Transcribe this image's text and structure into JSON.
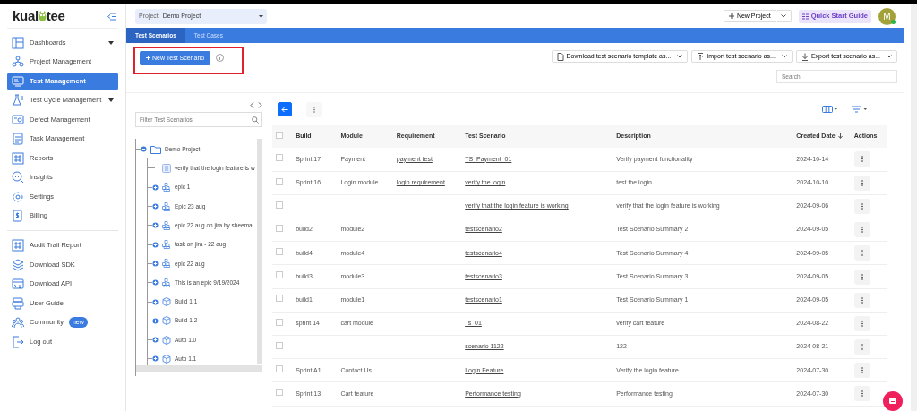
{
  "logo": {
    "text_start": "kual",
    "text_end": "tee"
  },
  "sidebar": {
    "groups": [
      [
        {
          "label": "Dashboards",
          "selected": false,
          "expanded": false
        },
        {
          "label": "Project Management",
          "selected": false
        },
        {
          "label": "Test Management",
          "selected": true
        },
        {
          "label": "Test Cycle Management",
          "selected": false,
          "expanded": false
        },
        {
          "label": "Defect Management",
          "selected": false
        },
        {
          "label": "Task Management",
          "selected": false
        },
        {
          "label": "Reports",
          "selected": false
        },
        {
          "label": "Insights",
          "selected": false
        },
        {
          "label": "Settings",
          "selected": false
        },
        {
          "label": "Billing",
          "selected": false
        }
      ],
      [
        {
          "label": "Audit Trail Report",
          "selected": false
        },
        {
          "label": "Download SDK",
          "selected": false
        },
        {
          "label": "Download API",
          "selected": false
        },
        {
          "label": "User Guide",
          "selected": false
        },
        {
          "label": "Community",
          "selected": false,
          "badge": "new"
        },
        {
          "label": "Log out",
          "selected": false
        }
      ]
    ]
  },
  "topbar": {
    "project_label": "Project:",
    "project": "Demo Project",
    "new_project": "New Project",
    "quick_start": "Quick Start Guide",
    "avatar": "M"
  },
  "tabs": [
    {
      "label": "Test Scenarios",
      "selected": true
    },
    {
      "label": "Test Cases",
      "selected": false
    }
  ],
  "new_button": "New Test Scenario",
  "actions": [
    {
      "label": "Download test scenario template as..."
    },
    {
      "label": "Import test scenario as..."
    },
    {
      "label": "Export test scenario as..."
    }
  ],
  "search": {
    "placeholder": "Search"
  },
  "tree": {
    "filter_placeholder": "Filter Test Scenarios",
    "nodes": [
      {
        "label": "Demo Project",
        "kind": "folder",
        "expanded": true,
        "children": [
          {
            "label": "verify that the login feature is w",
            "kind": "scenario"
          },
          {
            "label": "epic 1",
            "kind": "epic",
            "expanded": false
          },
          {
            "label": "Epic 23 aug",
            "kind": "epic",
            "expanded": false
          },
          {
            "label": "epic 22 aug on jira by sheema",
            "kind": "epic",
            "expanded": false
          },
          {
            "label": "task on jira - 22 aug",
            "kind": "epic",
            "expanded": false
          },
          {
            "label": "epic 22 aug",
            "kind": "epic",
            "expanded": false
          },
          {
            "label": "This is an epic 9/19/2024",
            "kind": "epic",
            "expanded": false
          },
          {
            "label": "Build 1.1",
            "kind": "build",
            "expanded": false
          },
          {
            "label": "Build 1.2",
            "kind": "build",
            "expanded": false
          },
          {
            "label": "Auto 1.0",
            "kind": "build",
            "expanded": false
          },
          {
            "label": "Auto 1.1",
            "kind": "build",
            "expanded": false
          }
        ]
      }
    ]
  },
  "table": {
    "columns": [
      "Build",
      "Module",
      "Requirement",
      "Test Scenario",
      "Description",
      "Created Date",
      "Actions"
    ],
    "all_checked": false,
    "rows": [
      {
        "checked": false,
        "build": "Sprint 17",
        "module": "Payment",
        "requirement": "payment test",
        "scenario": "TS_Payment_01",
        "description": "Verify payment functionality",
        "date": "2024-10-14"
      },
      {
        "checked": false,
        "build": "Sprint 16",
        "module": "Login module",
        "requirement": "login requirement",
        "scenario": "verify the login",
        "description": "test the login",
        "date": "2024-10-10"
      },
      {
        "checked": false,
        "scenario": "verify that the login feature is working",
        "description": "verify that the login feature is working",
        "date": "2024-09-06"
      },
      {
        "checked": false,
        "build": "build2",
        "module": "module2",
        "scenario": "testscenario2",
        "description": "Test Scenario Summary 2",
        "date": "2024-09-05"
      },
      {
        "checked": false,
        "build": "build4",
        "module": "module4",
        "scenario": "testscenario4",
        "description": "Test Scenario Summary 4",
        "date": "2024-09-05"
      },
      {
        "checked": false,
        "build": "build3",
        "module": "module3",
        "scenario": "testscenario3",
        "description": "Test Scenario Summary 3",
        "date": "2024-09-05"
      },
      {
        "checked": false,
        "build": "build1",
        "module": "module1",
        "scenario": "testscenario1",
        "description": "Test Scenario Summary 1",
        "date": "2024-09-05"
      },
      {
        "checked": false,
        "build": "sprint 14",
        "module": "cart module",
        "scenario": "Ts_01",
        "description": "verify cart feature",
        "date": "2024-08-22"
      },
      {
        "checked": false,
        "scenario": "scenario 1122",
        "description": "122",
        "date": "2024-08-21"
      },
      {
        "checked": false,
        "build": "Sprint A1",
        "module": "Contact Us",
        "scenario": "Login Feature",
        "description": "Verify the login feature",
        "date": "2024-07-30"
      },
      {
        "checked": false,
        "build": "Sprint 13",
        "module": "Cart feature",
        "scenario": "Performance testing",
        "description": "Performance testing",
        "date": "2024-07-30"
      }
    ]
  }
}
